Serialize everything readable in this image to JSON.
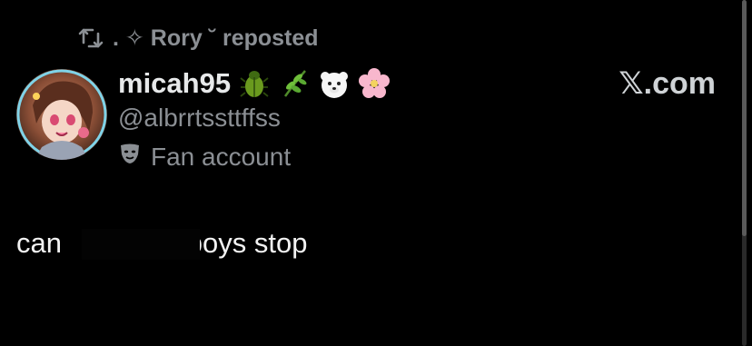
{
  "repost": {
    "icon": "repost-icon",
    "text": ". ✧ Rory ˘ reposted"
  },
  "author": {
    "avatar": "avatar",
    "display_name": "micah95",
    "emojis": [
      "beetle-emoji",
      "herb-emoji",
      "polar-bear-emoji",
      "cherry-blossom-emoji"
    ],
    "handle": "@albrrtssttffss",
    "label_icon": "theater-masks-icon",
    "label_text": "Fan account"
  },
  "site": {
    "mark": "𝕏.com"
  },
  "tweet": {
    "text_before": "can",
    "text_after": "femboys stop"
  },
  "colors": {
    "background": "#000000",
    "primary_text": "#e7e9ea",
    "secondary_text": "#8b8f94"
  }
}
